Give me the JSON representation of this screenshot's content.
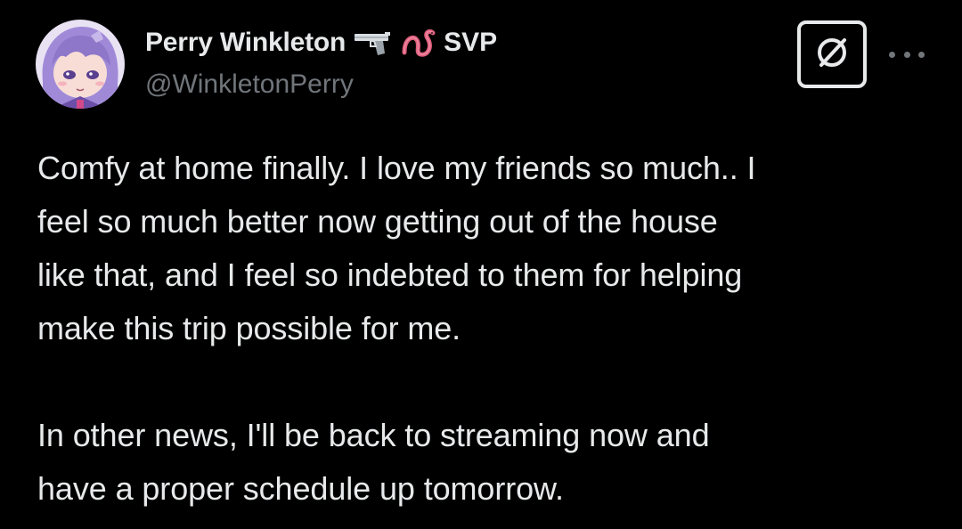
{
  "author": {
    "display_name": "Perry Winkleton",
    "emojis": [
      "pistol-icon",
      "worm-icon"
    ],
    "name_suffix": "SVP",
    "handle": "@WinkletonPerry"
  },
  "actions": {
    "grok_icon": "grok-slash-circle-icon",
    "more_icon": "ellipsis-icon"
  },
  "tweet": {
    "text": "Comfy at home finally. I love my friends so much.. I\nfeel so much better now getting out of the house\nlike that, and I feel so indebted to them for helping\nmake this trip possible for me.\n\nIn other news, I'll be back to streaming now and\nhave a proper schedule up tomorrow."
  },
  "colors": {
    "background": "#000000",
    "primary_text": "#e7e9ea",
    "secondary_text": "#71767b",
    "worm": "#e0607e",
    "avatar_hair": "#9b86d6"
  }
}
